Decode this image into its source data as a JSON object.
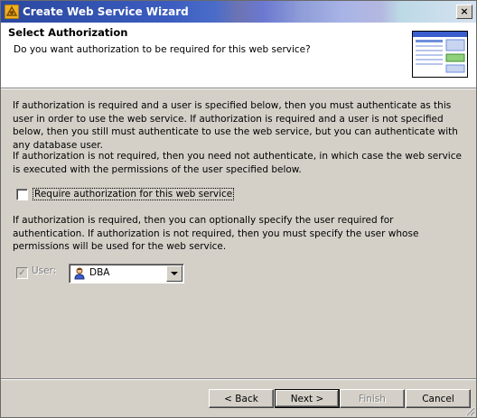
{
  "window": {
    "title": "Create Web Service Wizard",
    "close_glyph": "×"
  },
  "header": {
    "title": "Select Authorization",
    "subtitle": "Do you want authorization to be required for this web service?",
    "image_icon": "wizard-window-illustration"
  },
  "body": {
    "paragraph1": "If authorization is required and a user is specified below, then you must authenticate as this user in order to use the web service. If authorization is required and a user is not specified below, then you still must authenticate to use the web service, but you can authenticate with any database user.",
    "paragraph2": "If authorization is not required, then you need not authenticate, in which case the web service is executed with the permissions of the user specified below.",
    "require_auth": {
      "label": "Require authorization for this web service",
      "checked": false
    },
    "paragraph3": "If authorization is required, then you can optionally specify the user required for authentication. If authorization is not required, then you must specify the user whose permissions will be used for the web service.",
    "user": {
      "label": "User:",
      "checked": true,
      "enabled": false,
      "selected_value": "DBA",
      "icon": "user-icon"
    }
  },
  "buttons": {
    "back": "< Back",
    "next": "Next >",
    "finish": "Finish",
    "cancel": "Cancel"
  }
}
